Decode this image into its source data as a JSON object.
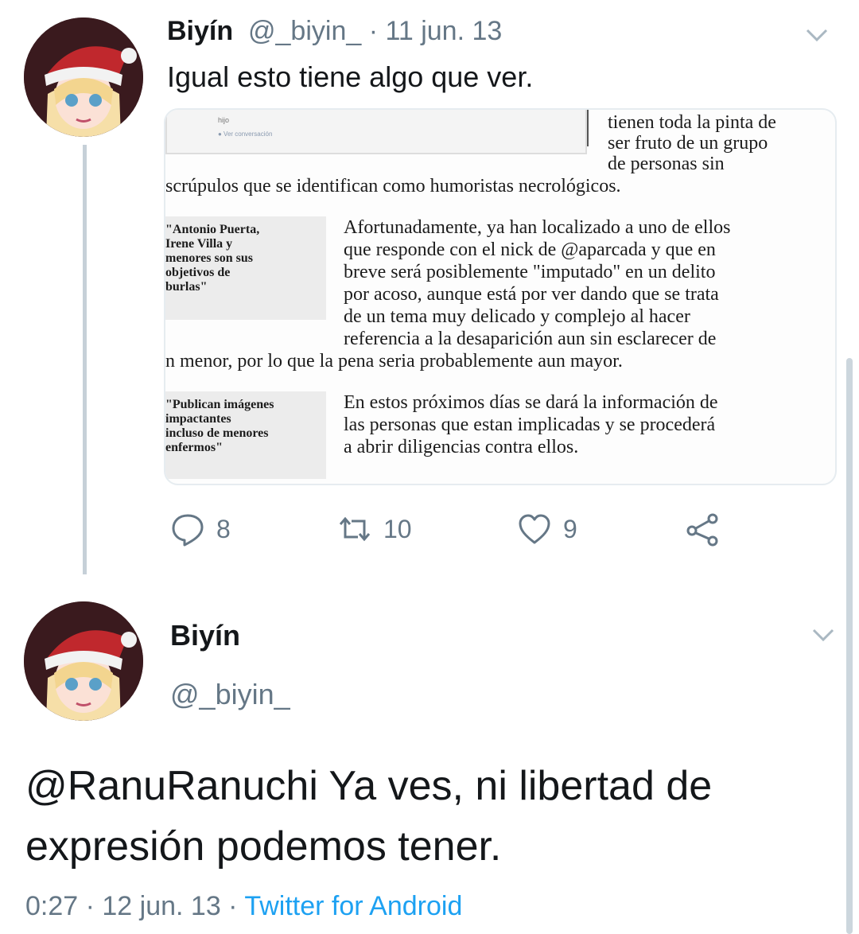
{
  "tweet1": {
    "display_name": "Biyín",
    "meta": "@_biyin_ · 11 jun. 13",
    "text": "Igual esto tiene algo que ver.",
    "media": {
      "embed_label_1": "hijo",
      "embed_label_2": "● Ver conversación",
      "lines_top": [
        "tienen toda la pinta de",
        "ser fruto de un grupo",
        "de personas sin",
        "scrúpulos que se identifican como humoristas necrológicos."
      ],
      "quote1": [
        "\"Antonio Puerta,",
        "Irene Villa y",
        "menores son sus",
        "objetivos de",
        "burlas\""
      ],
      "para1": [
        "Afortunadamente, ya han localizado a uno de ellos",
        "que responde con el nick de @aparcada y que en",
        "breve será posiblemente \"imputado\" en un delito",
        "por acoso, aunque está por ver dando que se trata",
        "de un tema muy delicado y complejo al hacer",
        "referencia a la desaparición aun sin esclarecer de",
        "n menor, por lo que la pena seria probablemente aun mayor."
      ],
      "quote2": [
        "\"Publican imágenes",
        "impactantes",
        "incluso de menores",
        "enfermos\""
      ],
      "para2": [
        "En estos próximos días se dará la información de",
        "las personas que estan implicadas y se procederá",
        "a abrir diligencias contra ellos."
      ]
    },
    "actions": {
      "replies": "8",
      "retweets": "10",
      "likes": "9"
    }
  },
  "tweet2": {
    "display_name": "Biyín",
    "handle": "@_biyin_",
    "text": "@RanuRanuchi Ya ves, ni libertad de expresión podemos tener.",
    "time": "0:27 · 12 jun. 13 · ",
    "source": "Twitter for Android"
  },
  "icons": [
    "avatar-santa-hat",
    "chevron-down-icon",
    "reply-icon",
    "retweet-icon",
    "like-icon",
    "share-icon"
  ],
  "colors": {
    "secondary_text": "#657786",
    "link": "#1da1f2",
    "avatar_hat": "#c0282d"
  }
}
